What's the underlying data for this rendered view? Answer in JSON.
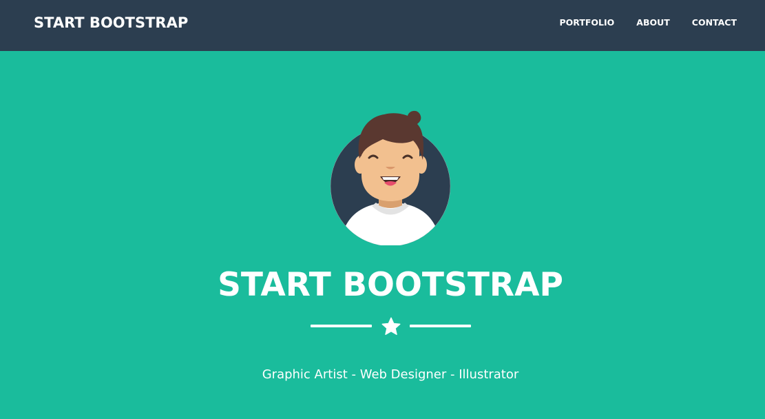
{
  "navbar": {
    "brand": "START BOOTSTRAP",
    "links": [
      {
        "label": "PORTFOLIO"
      },
      {
        "label": "ABOUT"
      },
      {
        "label": "CONTACT"
      }
    ]
  },
  "hero": {
    "title": "START BOOTSTRAP",
    "subtitle": "Graphic Artist - Web Designer - Illustrator",
    "divider_icon": "star-icon",
    "avatar_icon": "avatar-illustration"
  },
  "colors": {
    "primary": "#1abc9c",
    "secondary": "#2c3e50",
    "text": "#ffffff"
  }
}
